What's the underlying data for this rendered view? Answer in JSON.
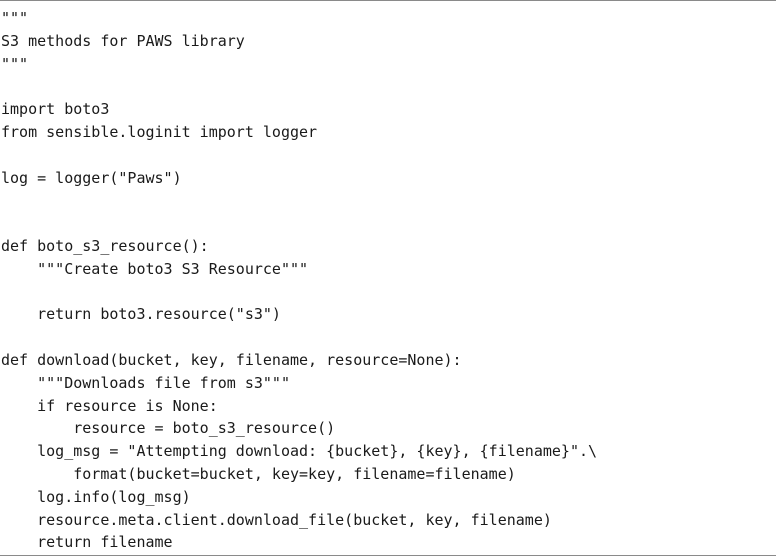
{
  "code": {
    "lines": [
      "\"\"\"",
      "S3 methods for PAWS library",
      "\"\"\"",
      "",
      "import boto3",
      "from sensible.loginit import logger",
      "",
      "log = logger(\"Paws\")",
      "",
      "",
      "def boto_s3_resource():",
      "    \"\"\"Create boto3 S3 Resource\"\"\"",
      "",
      "    return boto3.resource(\"s3\")",
      "",
      "def download(bucket, key, filename, resource=None):",
      "    \"\"\"Downloads file from s3\"\"\"",
      "    if resource is None:",
      "        resource = boto_s3_resource()",
      "    log_msg = \"Attempting download: {bucket}, {key}, {filename}\".\\",
      "        format(bucket=bucket, key=key, filename=filename)",
      "    log.info(log_msg)",
      "    resource.meta.client.download_file(bucket, key, filename)",
      "    return filename"
    ]
  }
}
